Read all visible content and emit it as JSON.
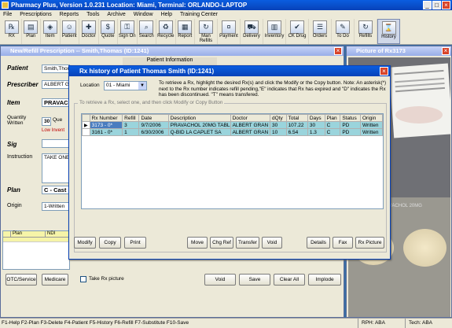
{
  "app": {
    "title": "Pharmacy Plus, Version 1.0.231  Location: Miami, Terminal: ORLANDO-LAPTOP"
  },
  "menu": [
    "File",
    "Prescriptions",
    "Reports",
    "Tools",
    "Archive",
    "Window",
    "Help",
    "Training Center"
  ],
  "toolbar": [
    {
      "label": "RX",
      "icon": "rx-icon"
    },
    {
      "label": "Plan",
      "icon": "plan-icon"
    },
    {
      "label": "Item",
      "icon": "item-icon"
    },
    {
      "label": "Patient",
      "icon": "patient-icon"
    },
    {
      "label": "Doctor",
      "icon": "doctor-icon"
    },
    {
      "label": "Quote",
      "icon": "quote-icon"
    },
    {
      "label": "Sign On",
      "icon": "sign-on-icon"
    },
    {
      "label": "Search",
      "icon": "search-icon"
    },
    {
      "label": "Recycle",
      "icon": "recycle-icon"
    },
    {
      "label": "Report",
      "icon": "report-icon"
    },
    {
      "label": "Man Refills",
      "icon": "refills-icon"
    },
    {
      "label": "Payment",
      "icon": "payment-icon"
    },
    {
      "label": "Delivery",
      "icon": "delivery-icon"
    },
    {
      "label": "Inventory",
      "icon": "inventory-icon"
    },
    {
      "label": "CK Drug",
      "icon": "drug-icon"
    },
    {
      "label": "Orders",
      "icon": "orders-icon"
    },
    {
      "label": "To Do",
      "icon": "todo-icon"
    },
    {
      "label": "Refills",
      "icon": "refills-icon"
    },
    {
      "label": "History",
      "icon": "history-icon"
    }
  ],
  "left_window": {
    "title": "New/Refill Prescription -- Smith,Thomas (ID:1241)",
    "patient_info_header": "Patient Information",
    "patient_label": "Patient",
    "patient_value": "Smith,Thom",
    "prescriber_label": "Prescriber",
    "prescriber_value": "ALBERT G",
    "item_label": "Item",
    "item_value": "PRAVACH",
    "qty_label": "Quantity Written",
    "qty_value": "30",
    "qty_side": "Que",
    "low_inventory": "Low Invent",
    "sig_label": "Sig",
    "instruction_label": "Instruction",
    "instruction_value": "TAKE ONE",
    "plan_label": "Plan",
    "plan_value": "C - Cast",
    "origin_label": "Origin",
    "origin_value": "1-Written",
    "grid_headers": [
      "Plan",
      "NDI"
    ],
    "buttons": {
      "otc": "OTC/Service",
      "medicare": "Medicare",
      "take_rx": "Take Rx picture",
      "void": "Void",
      "save": "Save",
      "clear_all": "Clear All",
      "implode": "Implode"
    }
  },
  "right_window": {
    "title": "Picture of Rx3173",
    "pill_caption": "PRAVACHOL 20MG"
  },
  "dialog": {
    "title": "Rx history of Patient Thomas Smith (ID:1241)",
    "location_label": "Location",
    "location_value": "01 - Miami",
    "info": "To retrieve a Rx, highlight the desired Rx(s) and click the Modify or the Copy button.  Note: An asterisk(*) next to the Rx number indicates refill pending,\"E\" indicates that Rx has expired and \"D\" indicates the Rx has been discontinued. \"T\" means transfered.",
    "group_label": "To retrieve a Rx, select one, and then click Modify or Copy Button",
    "columns": [
      "Rx Number",
      "Refill",
      "Date",
      "Description",
      "Doctor",
      "dQty",
      "Total",
      "Days",
      "Plan",
      "Status",
      "Origin"
    ],
    "rows": [
      [
        "3173 - 0*",
        "3",
        "9/7/2006",
        "PRAVACHOL 20MG TABL",
        "ALBERT GRAN",
        "30",
        "107.22",
        "30",
        "C",
        "PD",
        "Written"
      ],
      [
        "3161 - 0*",
        "1",
        "6/30/2006",
        "Q-BID LA CAPLET SA",
        "ALBERT GRAN",
        "10",
        "6.54",
        "1.3",
        "C",
        "PD",
        "Written"
      ]
    ],
    "buttons": {
      "modify": "Modify",
      "copy": "Copy",
      "print": "Print",
      "move": "Move",
      "chg_ref": "Chg Ref",
      "transfer": "Transfer",
      "void": "Void",
      "details": "Details",
      "fax": "Fax",
      "rx_picture": "Rx Picture"
    }
  },
  "statusbar": {
    "text": "F1-Help  F2-Plan  F3-Delete  F4-Patient  F5-History  F6-Refill  F7-Substitute  F10-Save",
    "rph": "RPH: ABA",
    "tech": "Tech: ABA"
  }
}
